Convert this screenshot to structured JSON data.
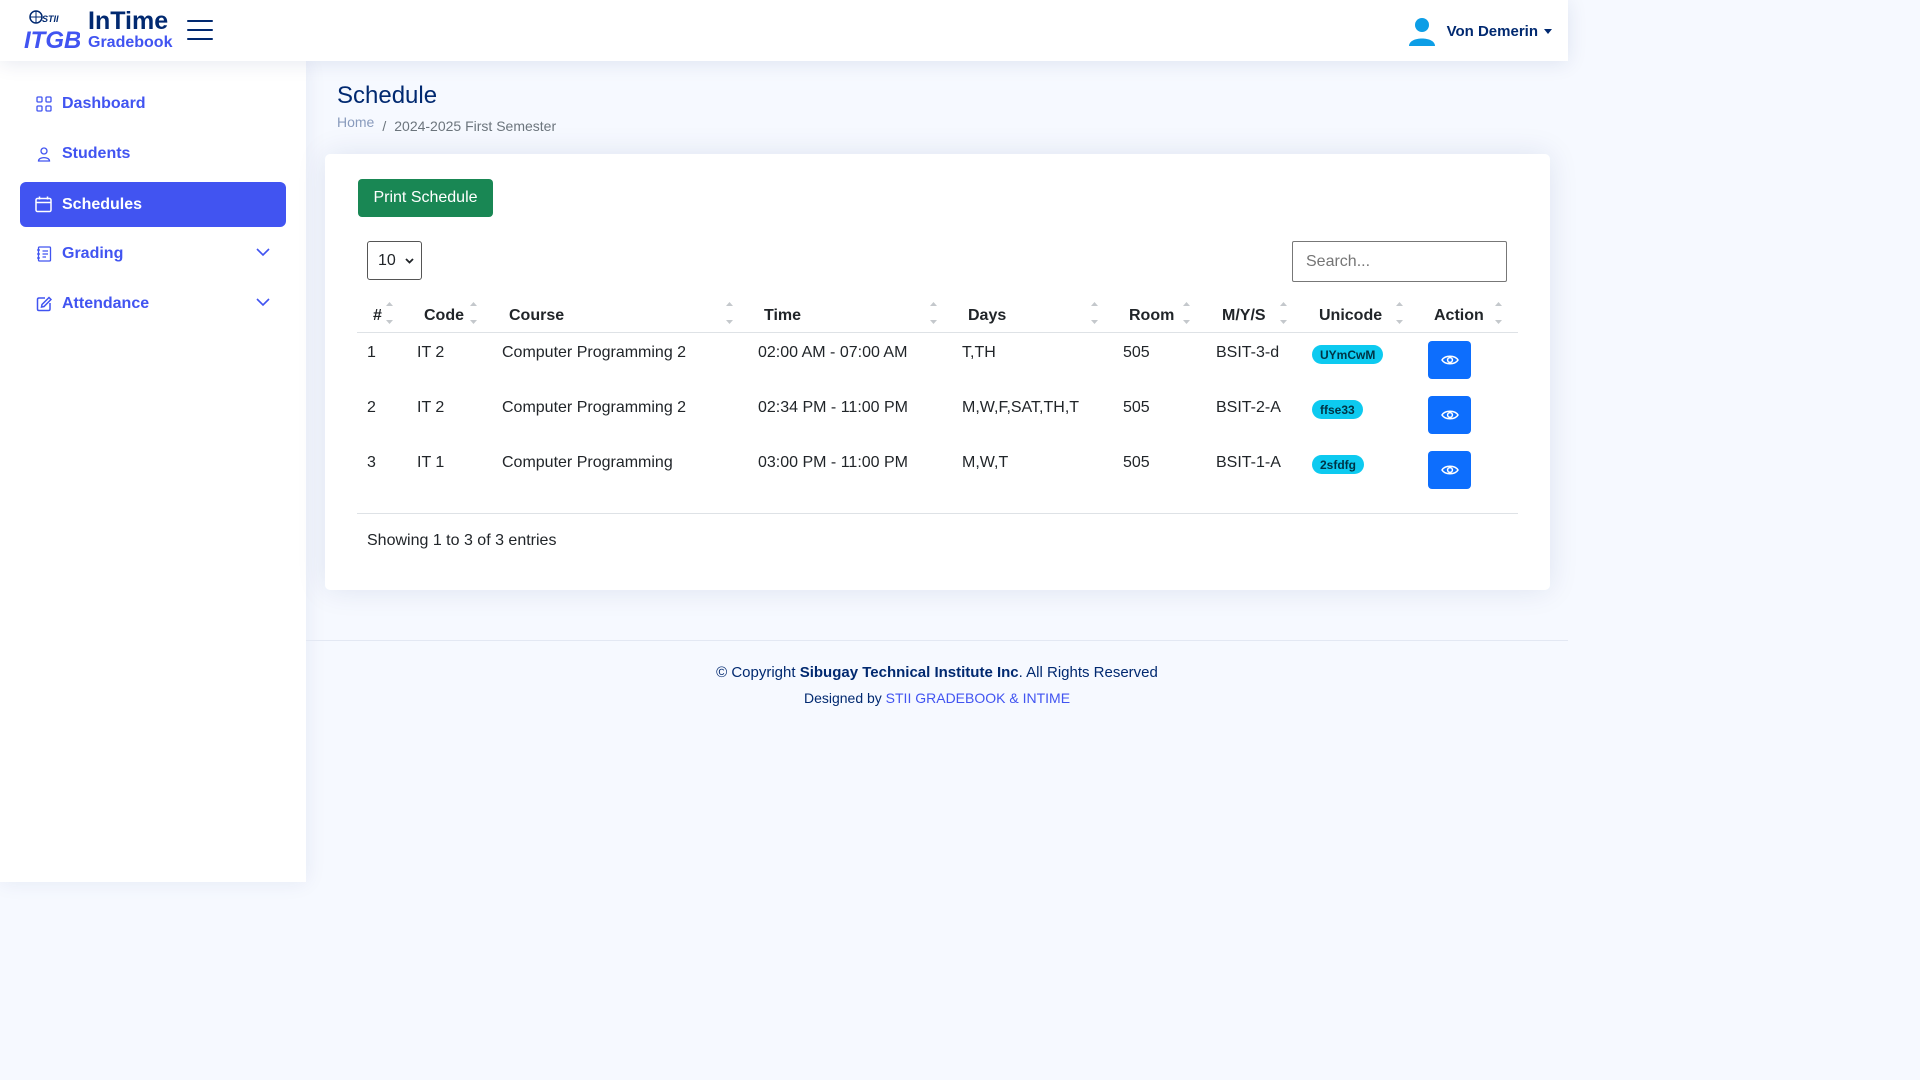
{
  "header": {
    "logo_title": "InTime",
    "logo_subtitle": "Gradebook",
    "user_name": "Von Demerin"
  },
  "sidebar": {
    "items": [
      {
        "label": "Dashboard",
        "icon": "grid-icon"
      },
      {
        "label": "Students",
        "icon": "person-icon"
      },
      {
        "label": "Schedules",
        "icon": "calendar-icon",
        "active": true
      },
      {
        "label": "Grading",
        "icon": "journal-icon",
        "expandable": true
      },
      {
        "label": "Attendance",
        "icon": "edit-square-icon",
        "expandable": true
      }
    ]
  },
  "page": {
    "title": "Schedule",
    "breadcrumb": {
      "home": "Home",
      "separator": "/",
      "current": "2024-2025 First Semester"
    }
  },
  "card": {
    "print_button": "Print Schedule",
    "page_length": "10",
    "search_placeholder": "Search...",
    "columns": [
      "#",
      "Code",
      "Course",
      "Time",
      "Days",
      "Room",
      "M/Y/S",
      "Unicode",
      "Action"
    ],
    "rows": [
      {
        "num": "1",
        "code": "IT 2",
        "course": "Computer Programming 2",
        "time": "02:00 AM - 07:00 AM",
        "days": "T,TH",
        "room": "505",
        "mys": "BSIT-3-d",
        "unicode": "UYmCwM"
      },
      {
        "num": "2",
        "code": "IT 2",
        "course": "Computer Programming 2",
        "time": "02:34 PM - 11:00 PM",
        "days": "M,W,F,SAT,TH,T",
        "room": "505",
        "mys": "BSIT-2-A",
        "unicode": "ffse33"
      },
      {
        "num": "3",
        "code": "IT 1",
        "course": "Computer Programming",
        "time": "03:00 PM - 11:00 PM",
        "days": "M,W,T",
        "room": "505",
        "mys": "BSIT-1-A",
        "unicode": "2sfdfg"
      }
    ],
    "info": "Showing 1 to 3 of 3 entries"
  },
  "footer": {
    "copyright_prefix": "© Copyright ",
    "company": "Sibugay Technical Institute Inc",
    "copyright_suffix": ". All Rights Reserved",
    "designed_by": "Designed by ",
    "designer": "STII GRADEBOOK & INTIME"
  },
  "colors": {
    "primary": "#4154f1",
    "navy": "#012970",
    "success": "#198754",
    "info_badge": "#0dcaf0",
    "button_blue": "#0d6efd",
    "background": "#f6f9ff"
  }
}
